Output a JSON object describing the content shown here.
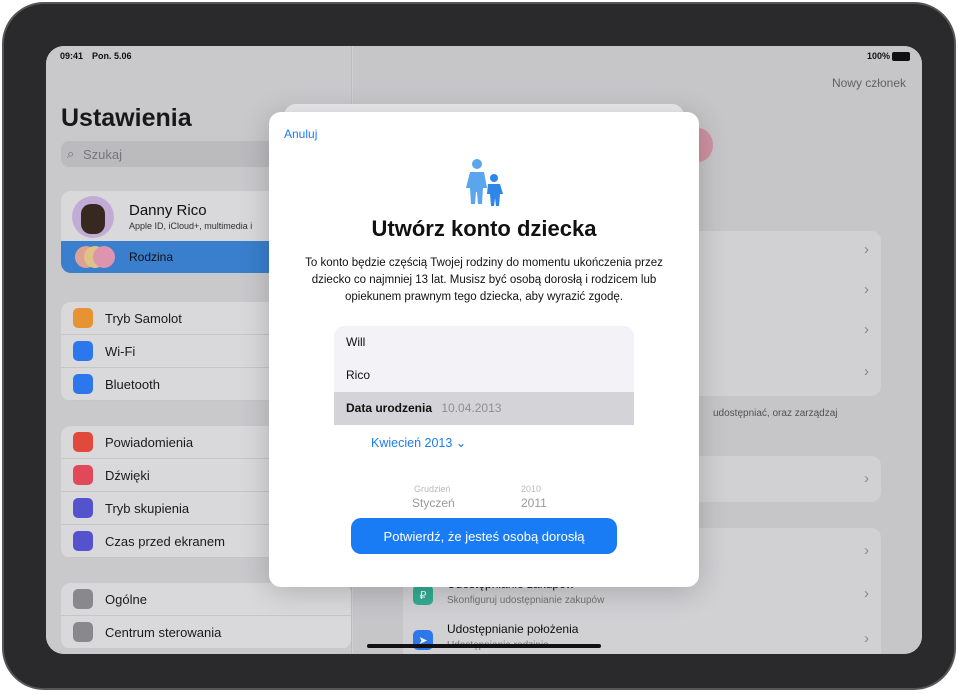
{
  "status": {
    "time": "09:41",
    "date": "Pon. 5.06",
    "battery": "100%"
  },
  "sidebar": {
    "title": "Ustawienia",
    "search_placeholder": "Szukaj",
    "profile": {
      "name": "Danny Rico",
      "subtitle": "Apple ID, iCloud+, multimedia i"
    },
    "family": "Rodzina",
    "groups": [
      [
        {
          "label": "Tryb Samolot",
          "icon": "airplane-icon",
          "color": "#f19a37"
        },
        {
          "label": "Wi-Fi",
          "icon": "wifi-icon",
          "color": "#2f7cf6"
        },
        {
          "label": "Bluetooth",
          "icon": "bluetooth-icon",
          "color": "#2f7cf6"
        }
      ],
      [
        {
          "label": "Powiadomienia",
          "icon": "bell-icon",
          "color": "#eb4d3d"
        },
        {
          "label": "Dźwięki",
          "icon": "speaker-icon",
          "color": "#eb4d5d"
        },
        {
          "label": "Tryb skupienia",
          "icon": "moon-icon",
          "color": "#5856d6"
        },
        {
          "label": "Czas przed ekranem",
          "icon": "hourglass-icon",
          "color": "#5856d6"
        }
      ],
      [
        {
          "label": "Ogólne",
          "icon": "gear-icon",
          "color": "#8e8e93"
        },
        {
          "label": "Centrum sterowania",
          "icon": "switches-icon",
          "color": "#8e8e93"
        }
      ]
    ]
  },
  "detail": {
    "new_member": "Nowy członek",
    "note": "udostępniać, oraz zarządzaj",
    "purchase": {
      "title": "Udostępnianie zakupów",
      "subtitle": "Skonfiguruj udostępnianie zakupów"
    },
    "location": {
      "title": "Udostępnianie położenia",
      "subtitle": "Udostępnianie rodzinie"
    }
  },
  "modal": {
    "cancel": "Anuluj",
    "title": "Utwórz konto dziecka",
    "body": "To konto będzie częścią Twojej rodziny do momentu ukończenia przez dziecko co najmniej 13 lat. Musisz być osobą dorosłą i rodzicem lub opiekunem prawnym tego dziecka, aby wyrazić zgodę.",
    "first_name": "Will",
    "last_name": "Rico",
    "dob_label": "Data urodzenia",
    "dob_value": "10.04.2013",
    "month_picker": "Kwiecień 2013",
    "wheel": {
      "months": [
        "Grudzień",
        "Styczeń"
      ],
      "years": [
        "2010",
        "2011"
      ]
    },
    "confirm": "Potwierdź, że jesteś osobą dorosłą"
  },
  "colors": {
    "accent": "#1a7cf5"
  }
}
